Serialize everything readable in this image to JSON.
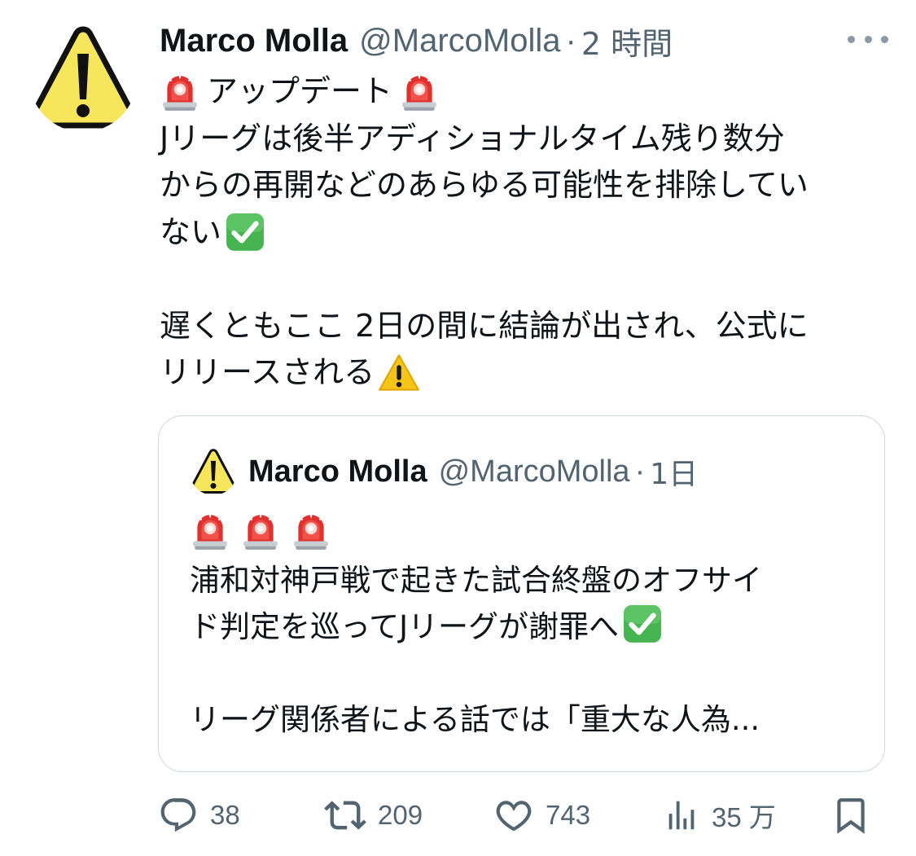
{
  "tweet": {
    "display_name": "Marco Molla",
    "handle": "@MarcoMolla",
    "separator": "·",
    "time": "2 時間",
    "lines": [
      "アップデート",
      "Jリーグは後半アディショナルタイム残り数分",
      "からの再開などのあらゆる可能性を排除してい",
      "ない",
      "遅くともここ 2日の間に結論が出され、公式に",
      "リリースされる"
    ]
  },
  "quote": {
    "display_name": "Marco Molla",
    "handle": "@MarcoMolla",
    "separator": "·",
    "time": "1日",
    "lines": [
      "浦和対神戸戦で起きた試合終盤のオフサイ",
      "ド判定を巡ってJリーグが謝罪へ",
      "リーグ関係者による話では「重大な人為..."
    ]
  },
  "actions": {
    "replies": "38",
    "retweets": "209",
    "likes": "743",
    "views": "35 万"
  },
  "icons": {
    "avatar": "warning-sign-icon",
    "siren": "rotating-light-icon",
    "check": "check-mark-button-icon",
    "warning": "warning-icon",
    "more": "more-dots-icon",
    "reply": "reply-icon",
    "retweet": "retweet-icon",
    "like": "heart-icon",
    "views": "views-chart-icon",
    "bookmark": "bookmark-icon"
  },
  "colors": {
    "text": "#0f1419",
    "secondary": "#536471",
    "border": "#cfd9de",
    "warning_yellow": "#f7e55b",
    "siren_red": "#e0312e",
    "check_green": "#46b450"
  }
}
